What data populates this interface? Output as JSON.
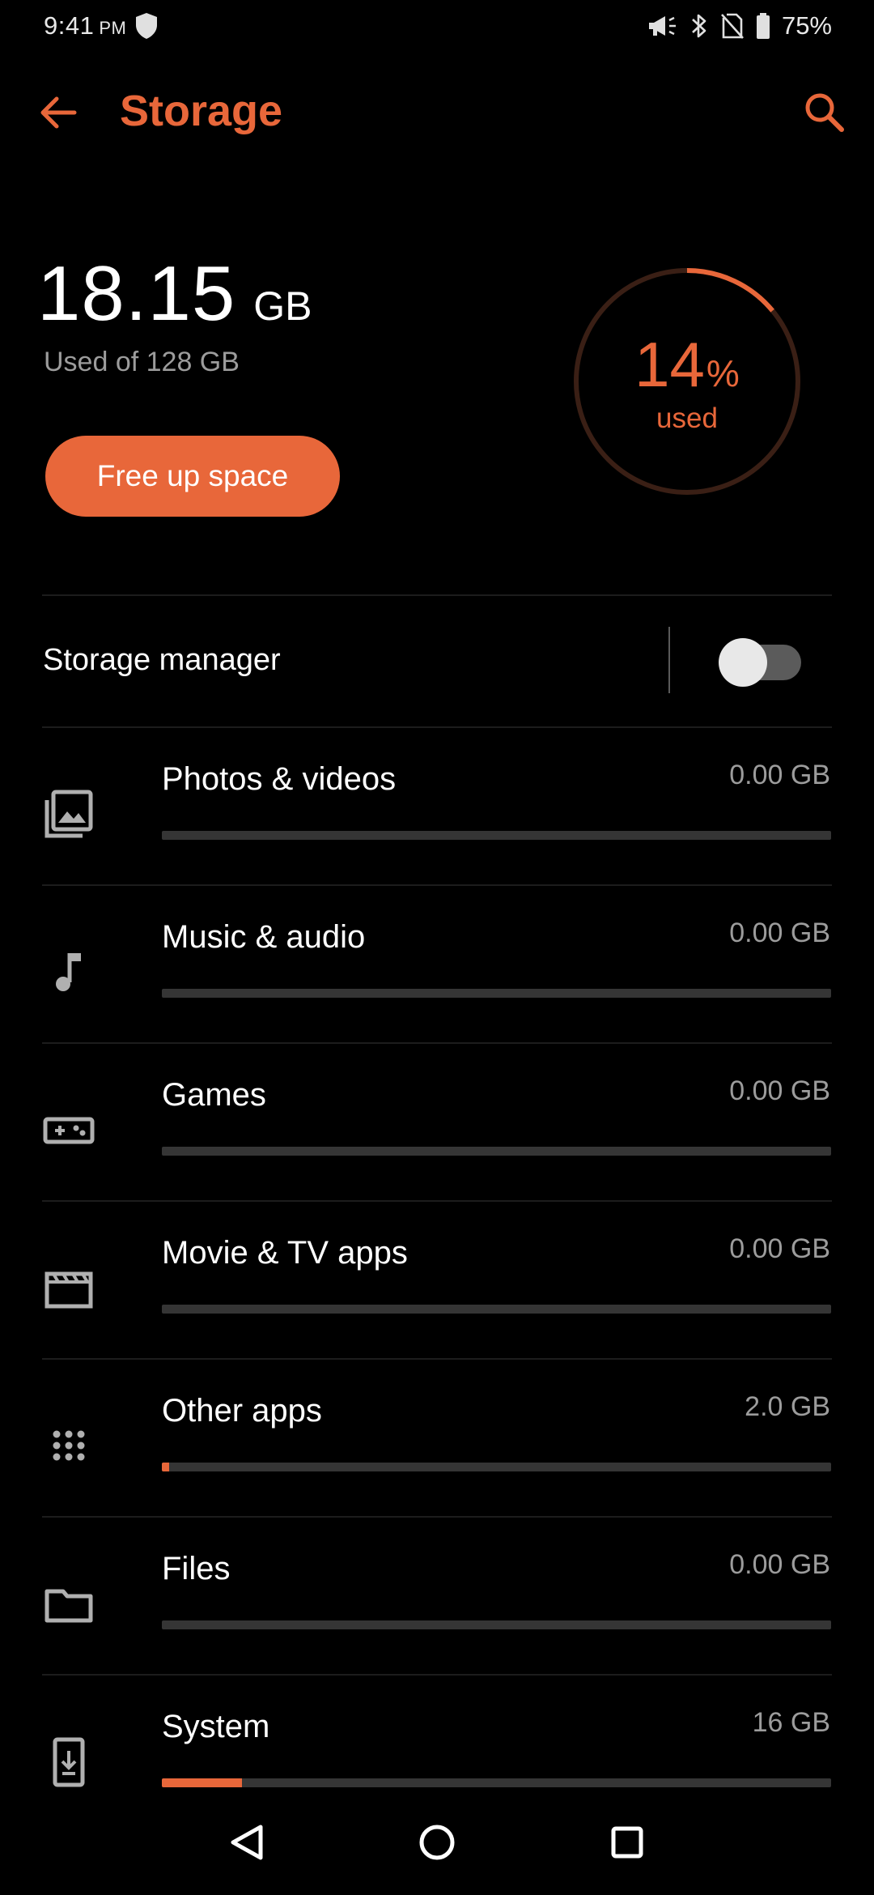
{
  "status_bar": {
    "time": "9:41",
    "ampm": "PM",
    "battery": "75%",
    "icons": [
      "shield-icon",
      "megaphone-icon",
      "bluetooth-icon",
      "no-sim-icon",
      "battery-icon"
    ]
  },
  "app_bar": {
    "title": "Storage",
    "back_icon": "arrow-left-icon",
    "search_icon": "search-icon"
  },
  "summary": {
    "used_value": "18.15",
    "used_unit": "GB",
    "used_of": "Used of 128 GB",
    "free_up_label": "Free up space",
    "percent_value": "14",
    "percent_sign": "%",
    "percent_label": "used",
    "percent_fraction": 0.14
  },
  "storage_manager": {
    "label": "Storage manager",
    "enabled": false
  },
  "categories": [
    {
      "label": "Photos & videos",
      "size": "0.00 GB",
      "icon": "photo-library-icon",
      "fraction": 0.0
    },
    {
      "label": "Music & audio",
      "size": "0.00 GB",
      "icon": "music-note-icon",
      "fraction": 0.0
    },
    {
      "label": "Games",
      "size": "0.00 GB",
      "icon": "gamepad-icon",
      "fraction": 0.0
    },
    {
      "label": "Movie & TV apps",
      "size": "0.00 GB",
      "icon": "movie-icon",
      "fraction": 0.0
    },
    {
      "label": "Other apps",
      "size": "2.0 GB",
      "icon": "apps-grid-icon",
      "fraction": 0.011
    },
    {
      "label": "Files",
      "size": "0.00 GB",
      "icon": "folder-icon",
      "fraction": 0.0
    },
    {
      "label": "System",
      "size": "16 GB",
      "icon": "system-update-icon",
      "fraction": 0.12
    }
  ],
  "colors": {
    "accent": "#e8673a",
    "background": "#000000",
    "ring_track": "#3a1f15",
    "bar_track": "#353535"
  },
  "nav_bar": {
    "back_icon": "nav-back-icon",
    "home_icon": "nav-home-icon",
    "recents_icon": "nav-recents-icon"
  }
}
